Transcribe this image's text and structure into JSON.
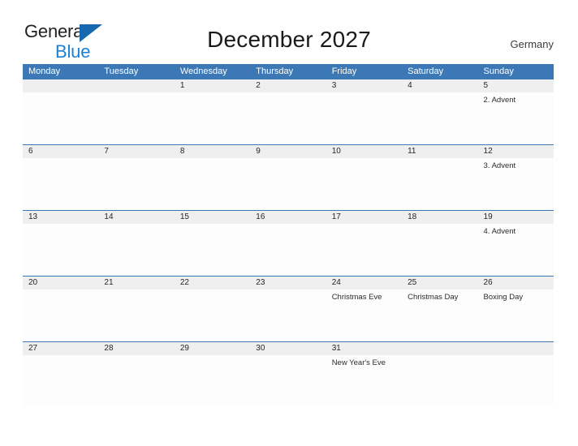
{
  "brand": {
    "name_part1": "General",
    "name_part2": "Blue",
    "flag_icon": "blue-flag-triangle"
  },
  "header": {
    "title": "December 2027",
    "country": "Germany"
  },
  "calendar": {
    "weekdays": [
      "Monday",
      "Tuesday",
      "Wednesday",
      "Thursday",
      "Friday",
      "Saturday",
      "Sunday"
    ],
    "weeks": [
      {
        "days": [
          {
            "num": "",
            "event": ""
          },
          {
            "num": "",
            "event": ""
          },
          {
            "num": "1",
            "event": ""
          },
          {
            "num": "2",
            "event": ""
          },
          {
            "num": "3",
            "event": ""
          },
          {
            "num": "4",
            "event": ""
          },
          {
            "num": "5",
            "event": "2. Advent"
          }
        ]
      },
      {
        "days": [
          {
            "num": "6",
            "event": ""
          },
          {
            "num": "7",
            "event": ""
          },
          {
            "num": "8",
            "event": ""
          },
          {
            "num": "9",
            "event": ""
          },
          {
            "num": "10",
            "event": ""
          },
          {
            "num": "11",
            "event": ""
          },
          {
            "num": "12",
            "event": "3. Advent"
          }
        ]
      },
      {
        "days": [
          {
            "num": "13",
            "event": ""
          },
          {
            "num": "14",
            "event": ""
          },
          {
            "num": "15",
            "event": ""
          },
          {
            "num": "16",
            "event": ""
          },
          {
            "num": "17",
            "event": ""
          },
          {
            "num": "18",
            "event": ""
          },
          {
            "num": "19",
            "event": "4. Advent"
          }
        ]
      },
      {
        "days": [
          {
            "num": "20",
            "event": ""
          },
          {
            "num": "21",
            "event": ""
          },
          {
            "num": "22",
            "event": ""
          },
          {
            "num": "23",
            "event": ""
          },
          {
            "num": "24",
            "event": "Christmas Eve"
          },
          {
            "num": "25",
            "event": "Christmas Day"
          },
          {
            "num": "26",
            "event": "Boxing Day"
          }
        ]
      },
      {
        "days": [
          {
            "num": "27",
            "event": ""
          },
          {
            "num": "28",
            "event": ""
          },
          {
            "num": "29",
            "event": ""
          },
          {
            "num": "30",
            "event": ""
          },
          {
            "num": "31",
            "event": "New Year's Eve"
          },
          {
            "num": "",
            "event": ""
          },
          {
            "num": "",
            "event": ""
          }
        ]
      }
    ]
  },
  "colors": {
    "header_blue": "#3b78b5",
    "logo_blue": "#1b7fd4",
    "flag_blue": "#1669b0",
    "daynum_band": "#efefef",
    "title_text": "#1a1a1a"
  }
}
